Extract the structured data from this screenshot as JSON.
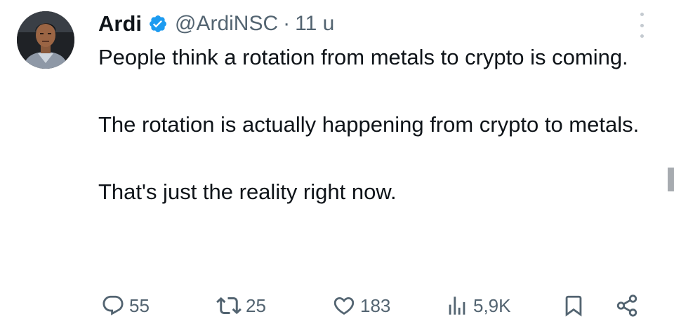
{
  "tweet": {
    "author": {
      "display_name": "Ardi",
      "handle": "@ArdiNSC",
      "verified": true,
      "avatar_icon": "profile-photo"
    },
    "separator": "·",
    "time": "11 u",
    "paragraphs": [
      "People think a rotation from metals to crypto is coming.",
      "The rotation is actually happening from crypto to metals.",
      "That's just the reality right now."
    ],
    "actions": {
      "reply": {
        "icon": "reply-icon",
        "count": "55"
      },
      "retweet": {
        "icon": "retweet-icon",
        "count": "25"
      },
      "like": {
        "icon": "heart-icon",
        "count": "183"
      },
      "views": {
        "icon": "views-icon",
        "count": "5,9K"
      },
      "bookmark": {
        "icon": "bookmark-icon"
      },
      "share": {
        "icon": "share-icon"
      }
    }
  },
  "colors": {
    "text_primary": "#0f1419",
    "text_secondary": "#536471",
    "verified_blue": "#1d9bf0"
  }
}
